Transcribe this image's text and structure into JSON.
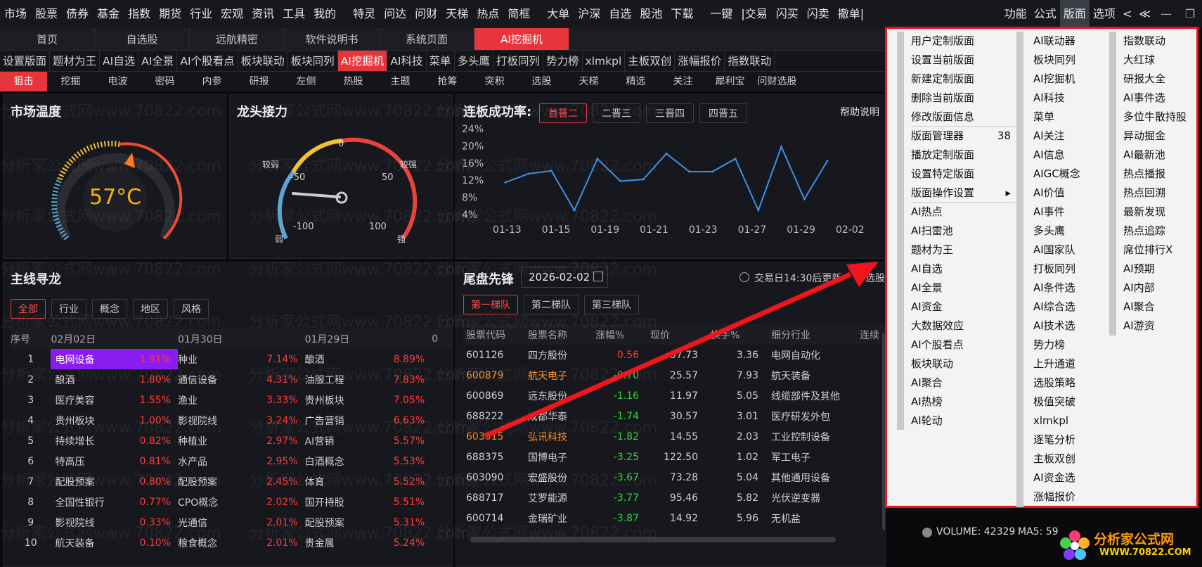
{
  "menubar": {
    "left": [
      "市场",
      "股票",
      "债券",
      "基金",
      "指数",
      "期货",
      "行业",
      "宏观",
      "资讯",
      "工具",
      "我的",
      "特灵",
      "问达",
      "问财",
      "天梯",
      "热点",
      "简框",
      "大单",
      "沪深",
      "自选",
      "股池",
      "下载",
      "一键",
      "|交易",
      "闪买",
      "闪卖",
      "撤单|"
    ],
    "right": [
      "功能",
      "公式",
      "版面",
      "选项",
      "<",
      "≪"
    ]
  },
  "tabs1": [
    "首页",
    "自选股",
    "远航精密",
    "软件说明书",
    "系统页面",
    "AI挖掘机"
  ],
  "tabs2": [
    "设置版面",
    "题材为王",
    "AI自选",
    "AI全景",
    "AI个股看点",
    "板块联动",
    "板块同列",
    "AI挖掘机",
    "AI科技",
    "菜单",
    "多头鹰",
    "打板同列",
    "势力榜",
    "xlmkpl",
    "主板双创",
    "涨幅报价",
    "指数联动"
  ],
  "tabs3": [
    "狙击",
    "挖掘",
    "电波",
    "密码",
    "内参",
    "研报",
    "左侧",
    "热股",
    "主题",
    "抢筹",
    "突积",
    "选股",
    "天梯",
    "精选",
    "关注",
    "犀利宝",
    "问财选股"
  ],
  "watermark": "分析家公式网www.70822.com",
  "temp": {
    "title": "市场温度",
    "value": "57°C"
  },
  "relay": {
    "title": "龙头接力",
    "labels": [
      "0",
      "-50",
      "50",
      "-100",
      "100",
      "较弱",
      "较强",
      "弱",
      "强"
    ]
  },
  "success": {
    "title": "连板成功率:",
    "tabs": [
      "首晋二",
      "二晋三",
      "三晋四",
      "四晋五"
    ],
    "help": "帮助说明"
  },
  "chart_data": {
    "type": "line",
    "x": [
      "01-13",
      "01-15",
      "01-19",
      "01-21",
      "01-23",
      "01-27",
      "01-29",
      "02-02"
    ],
    "yticks": [
      "24%",
      "20%",
      "16%",
      "12%",
      "8%",
      "4%"
    ],
    "ylim": [
      4,
      24
    ],
    "series": [
      {
        "values": [
          11.5,
          13.5,
          14.2,
          5,
          17,
          11.8,
          12.2,
          18.2,
          14,
          14,
          17,
          5,
          19.8,
          7.6,
          16.5
        ]
      }
    ]
  },
  "mainline": {
    "title": "主线寻龙",
    "chips": [
      "全部",
      "行业",
      "概念",
      "地区",
      "风格"
    ],
    "headers": [
      "序号",
      "02月02日",
      "01月30日",
      "01月29日",
      "0"
    ],
    "rows": [
      [
        "1",
        "电网设备",
        "1.91%",
        "种业",
        "7.14%",
        "酿酒",
        "8.89%"
      ],
      [
        "2",
        "酿酒",
        "1.80%",
        "通信设备",
        "4.31%",
        "油服工程",
        "7.83%"
      ],
      [
        "3",
        "医疗美容",
        "1.55%",
        "渔业",
        "3.33%",
        "贵州板块",
        "7.05%"
      ],
      [
        "4",
        "贵州板块",
        "1.00%",
        "影视院线",
        "3.24%",
        "广告营销",
        "6.63%"
      ],
      [
        "5",
        "持续增长",
        "0.82%",
        "种植业",
        "2.97%",
        "AI营销",
        "5.57%"
      ],
      [
        "6",
        "特高压",
        "0.81%",
        "水产品",
        "2.95%",
        "白酒概念",
        "5.53%"
      ],
      [
        "7",
        "配股预案",
        "0.80%",
        "配股预案",
        "2.45%",
        "体育",
        "5.52%"
      ],
      [
        "8",
        "全国性银行",
        "0.77%",
        "CPO概念",
        "2.02%",
        "国开持股",
        "5.51%"
      ],
      [
        "9",
        "影视院线",
        "0.33%",
        "光通信",
        "2.01%",
        "配股预案",
        "5.31%"
      ],
      [
        "10",
        "航天装备",
        "0.10%",
        "粮食概念",
        "2.01%",
        "贵金属",
        "5.24%"
      ]
    ]
  },
  "tail": {
    "title": "尾盘先锋",
    "date": "2026-02-02",
    "note": "交易日14:30后更新",
    "note2": "选股",
    "tabs": [
      "第一梯队",
      "第二梯队",
      "第三梯队"
    ],
    "headers": [
      "股票代码",
      "股票名称",
      "涨幅%",
      "现价",
      "换手%",
      "细分行业",
      "连续"
    ],
    "rows": [
      [
        "601126",
        "四方股份",
        "0.56",
        "37.73",
        "3.36",
        "电网自动化"
      ],
      [
        "600879",
        "航天电子",
        "-0.70",
        "25.57",
        "7.93",
        "航天装备"
      ],
      [
        "600869",
        "远东股份",
        "-1.16",
        "11.97",
        "5.05",
        "线缆部件及其他"
      ],
      [
        "688222",
        "成都华泰",
        "-1.74",
        "30.57",
        "3.01",
        "医疗研发外包"
      ],
      [
        "603015",
        "弘讯科技",
        "-1.82",
        "14.55",
        "2.03",
        "工业控制设备"
      ],
      [
        "688375",
        "国博电子",
        "-3.25",
        "122.50",
        "1.02",
        "军工电子"
      ],
      [
        "603090",
        "宏盛股份",
        "-3.67",
        "73.28",
        "5.04",
        "其他通用设备"
      ],
      [
        "688717",
        "艾罗能源",
        "-3.77",
        "95.46",
        "5.82",
        "光伏逆变器"
      ],
      [
        "600714",
        "金瑞矿业",
        "-3.87",
        "14.92",
        "5.96",
        "无机盐"
      ]
    ]
  },
  "volume": {
    "text": "VOLUME: 42329",
    "ma": "MA5: 59"
  },
  "logo": {
    "name": "分析家公式网",
    "url": "WWW.70822.COM"
  },
  "menu": {
    "col1": [
      "用户定制版面",
      "设置当前版面",
      "新建定制版面",
      "删除当前版面",
      "修改版面信息",
      "版面管理器",
      "播放定制版面",
      "设置特定版面",
      "版面操作设置",
      "AI热点",
      "AI扫雷池",
      "题材为王",
      "AI自选",
      "AI全景",
      "AI资金",
      "大数据效应",
      "AI个股看点",
      "板块联动",
      "AI聚合",
      "AI热榜",
      "AI轮动"
    ],
    "badge": "38",
    "col2": [
      "AI联动器",
      "板块同列",
      "AI挖掘机",
      "AI科技",
      "菜单",
      "AI关注",
      "AI信息",
      "AIGC概念",
      "AI价值",
      "AI事件",
      "多头鹰",
      "AI国家队",
      "打板同列",
      "AI条件选",
      "AI综合选",
      "AI技术选",
      "势力榜",
      "上升通道",
      "选股策略",
      "极值突破",
      "xlmkpl",
      "逐笔分析",
      "主板双创",
      "AI资金选",
      "涨幅报价"
    ],
    "col3": [
      "指数联动",
      "大红球",
      "研报大全",
      "AI事件选",
      "多位牛散持股",
      "异动掘金",
      "AI最新池",
      "热点播报",
      "热点回溯",
      "最新发现",
      "热点追踪",
      "席位排行X",
      "AI预期",
      "AI内部",
      "AI聚合",
      "AI游资"
    ]
  }
}
